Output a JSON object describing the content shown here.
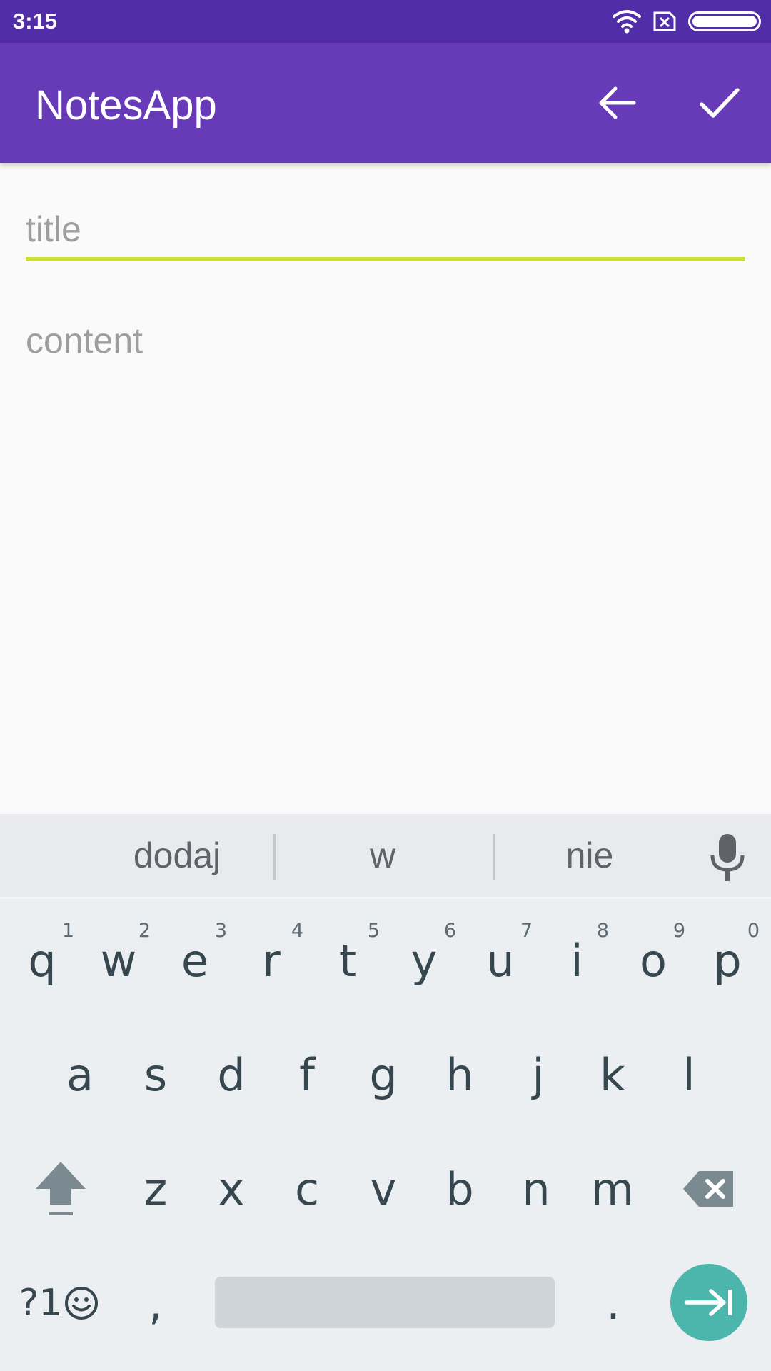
{
  "status_bar": {
    "time": "3:15",
    "icons": [
      "wifi-icon",
      "sim-x-icon",
      "battery-icon"
    ]
  },
  "app_bar": {
    "title": "NotesApp",
    "actions": [
      "back-arrow-icon",
      "check-icon"
    ]
  },
  "editor": {
    "title": {
      "value": "",
      "placeholder": "title"
    },
    "content": {
      "value": "",
      "placeholder": "content"
    }
  },
  "keyboard": {
    "suggestions": [
      "dodaj",
      "w",
      "nie"
    ],
    "row1": [
      {
        "label": "q",
        "hint": "1"
      },
      {
        "label": "w",
        "hint": "2"
      },
      {
        "label": "e",
        "hint": "3"
      },
      {
        "label": "r",
        "hint": "4"
      },
      {
        "label": "t",
        "hint": "5"
      },
      {
        "label": "y",
        "hint": "6"
      },
      {
        "label": "u",
        "hint": "7"
      },
      {
        "label": "i",
        "hint": "8"
      },
      {
        "label": "o",
        "hint": "9"
      },
      {
        "label": "p",
        "hint": "0"
      }
    ],
    "row2": [
      "a",
      "s",
      "d",
      "f",
      "g",
      "h",
      "j",
      "k",
      "l"
    ],
    "row3": [
      "z",
      "x",
      "c",
      "v",
      "b",
      "n",
      "m"
    ],
    "symbols_label": "?1",
    "comma": ",",
    "period": "."
  },
  "colors": {
    "status_bar": "#512da8",
    "app_bar": "#673ab7",
    "accent_underline": "#cddc39",
    "enter_key": "#4db6ac"
  }
}
